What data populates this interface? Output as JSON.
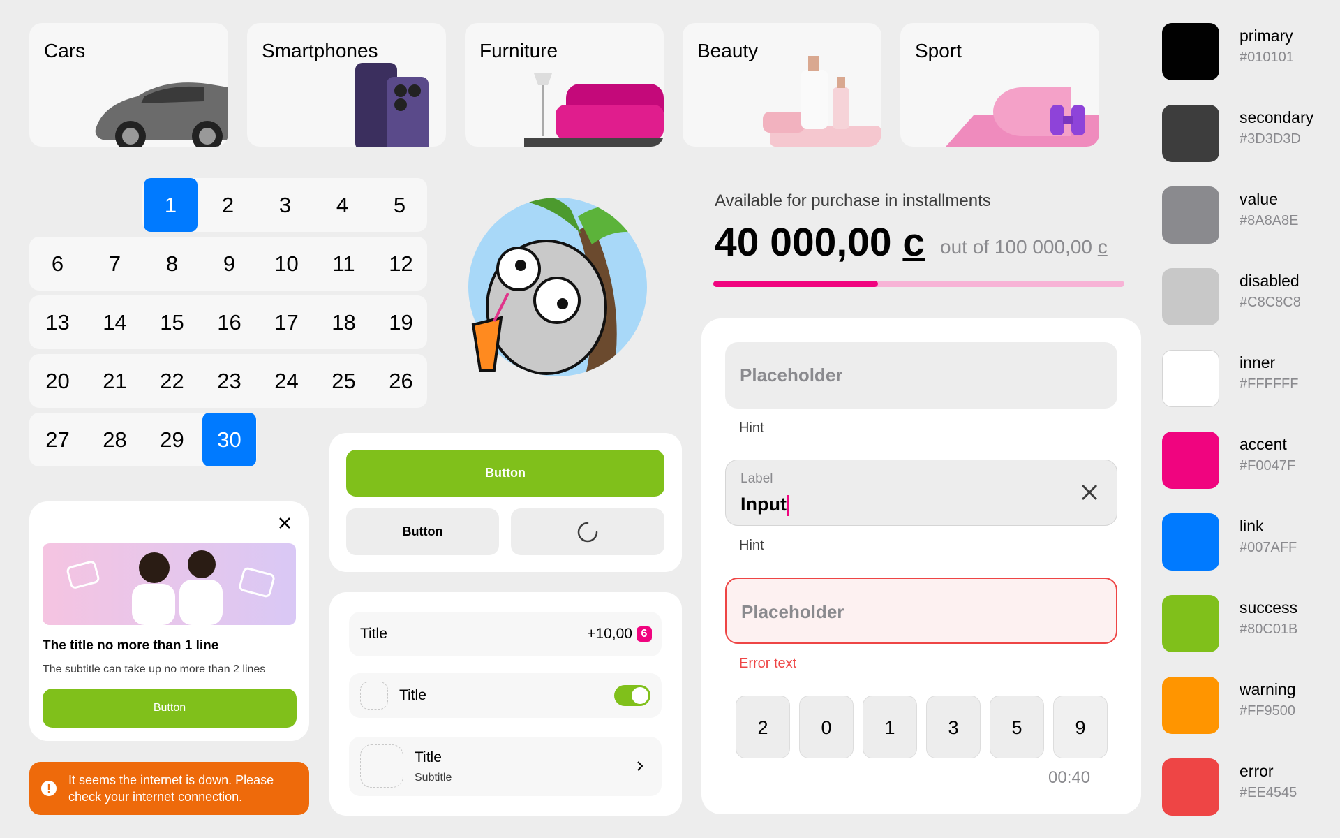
{
  "categories": [
    "Cars",
    "Smartphones",
    "Furniture",
    "Beauty",
    "Sport"
  ],
  "calendar": {
    "rows": [
      [
        "1",
        "2",
        "3",
        "4",
        "5"
      ],
      [
        "6",
        "7",
        "8",
        "9",
        "10",
        "11",
        "12"
      ],
      [
        "13",
        "14",
        "15",
        "16",
        "17",
        "18",
        "19"
      ],
      [
        "20",
        "21",
        "22",
        "23",
        "24",
        "25",
        "26"
      ],
      [
        "27",
        "28",
        "29",
        "30"
      ]
    ],
    "selected": [
      "1",
      "30"
    ]
  },
  "installments": {
    "caption": "Available for purchase in installments",
    "amount": "40 000,00",
    "currency": "c",
    "out_of": "out of 100 000,00",
    "progress": 0.4
  },
  "fields": {
    "placeholder1": "Placeholder",
    "hint1": "Hint",
    "label": "Label",
    "input_value": "Input",
    "hint2": "Hint",
    "placeholder_error": "Placeholder",
    "error_text": "Error text"
  },
  "otp": {
    "digits": [
      "2",
      "0",
      "1",
      "3",
      "5",
      "9"
    ],
    "timer": "00:40"
  },
  "buttons": {
    "primary": "Button",
    "secondary": "Button"
  },
  "list": {
    "row1_title": "Title",
    "row1_value": "+10,00",
    "row1_badge": "6",
    "row2_title": "Title",
    "row2_toggle_on": true,
    "row3_title": "Title",
    "row3_subtitle": "Subtitle"
  },
  "banner": {
    "title": "The title no more than 1 line",
    "subtitle": "The subtitle can take up no more than 2 lines",
    "button": "Button"
  },
  "toast": {
    "text": "It seems the internet is down. Please check your internet connection."
  },
  "palette": [
    {
      "name": "primary",
      "hex": "#010101"
    },
    {
      "name": "secondary",
      "hex": "#3D3D3D"
    },
    {
      "name": "value",
      "hex": "#8A8A8E"
    },
    {
      "name": "disabled",
      "hex": "#C8C8C8"
    },
    {
      "name": "inner",
      "hex": "#FFFFFF"
    },
    {
      "name": "accent",
      "hex": "#F0047F"
    },
    {
      "name": "link",
      "hex": "#007AFF"
    },
    {
      "name": "success",
      "hex": "#80C01B"
    },
    {
      "name": "warning",
      "hex": "#FF9500"
    },
    {
      "name": "error",
      "hex": "#EE4545"
    }
  ]
}
